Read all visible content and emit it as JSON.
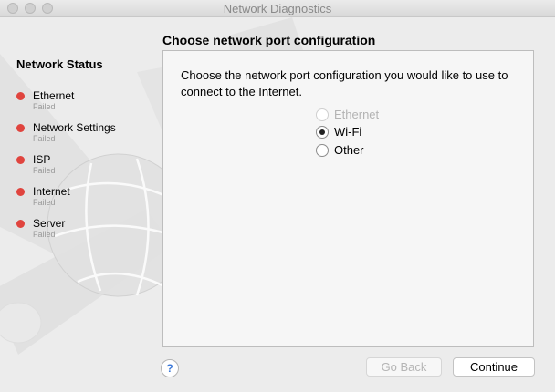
{
  "window": {
    "title": "Network Diagnostics"
  },
  "sidebar": {
    "heading": "Network Status",
    "items": [
      {
        "label": "Ethernet",
        "status": "Failed"
      },
      {
        "label": "Network Settings",
        "status": "Failed"
      },
      {
        "label": "ISP",
        "status": "Failed"
      },
      {
        "label": "Internet",
        "status": "Failed"
      },
      {
        "label": "Server",
        "status": "Failed"
      }
    ],
    "status_color": "#e0443e"
  },
  "main": {
    "section_title": "Choose network port configuration",
    "prompt": "Choose the network port configuration you would like to use to connect to the Internet.",
    "options": [
      {
        "label": "Ethernet",
        "selected": false,
        "enabled": false
      },
      {
        "label": "Wi-Fi",
        "selected": true,
        "enabled": true
      },
      {
        "label": "Other",
        "selected": false,
        "enabled": true
      }
    ]
  },
  "footer": {
    "help_label": "?",
    "back_label": "Go Back",
    "continue_label": "Continue"
  }
}
